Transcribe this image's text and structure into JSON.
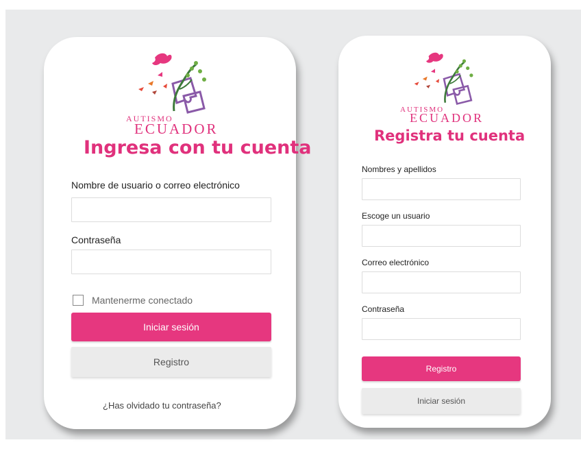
{
  "login": {
    "logo": {
      "line1": "AUTISMO",
      "line2": "ECUADOR"
    },
    "title": "Ingresa con tu cuenta",
    "username_label": "Nombre de usuario o correo electrónico",
    "password_label": "Contraseña",
    "remember_label": "Mantenerme conectado",
    "login_button": "Iniciar sesión",
    "register_button": "Registro",
    "forgot_link": "¿Has olvidado tu contraseña?"
  },
  "register": {
    "logo": {
      "line1": "AUTISMO",
      "line2": "ECUADOR"
    },
    "title": "Registra tu cuenta",
    "name_label": "Nombres y apellidos",
    "user_label": "Escoge un usuario",
    "email_label": "Correo electrónico",
    "password_label": "Contraseña",
    "register_button": "Registro",
    "login_button": "Iniciar sesión"
  },
  "colors": {
    "brand_pink": "#e6377f",
    "background": "#e9eaeb",
    "secondary_button": "#ebebeb"
  }
}
